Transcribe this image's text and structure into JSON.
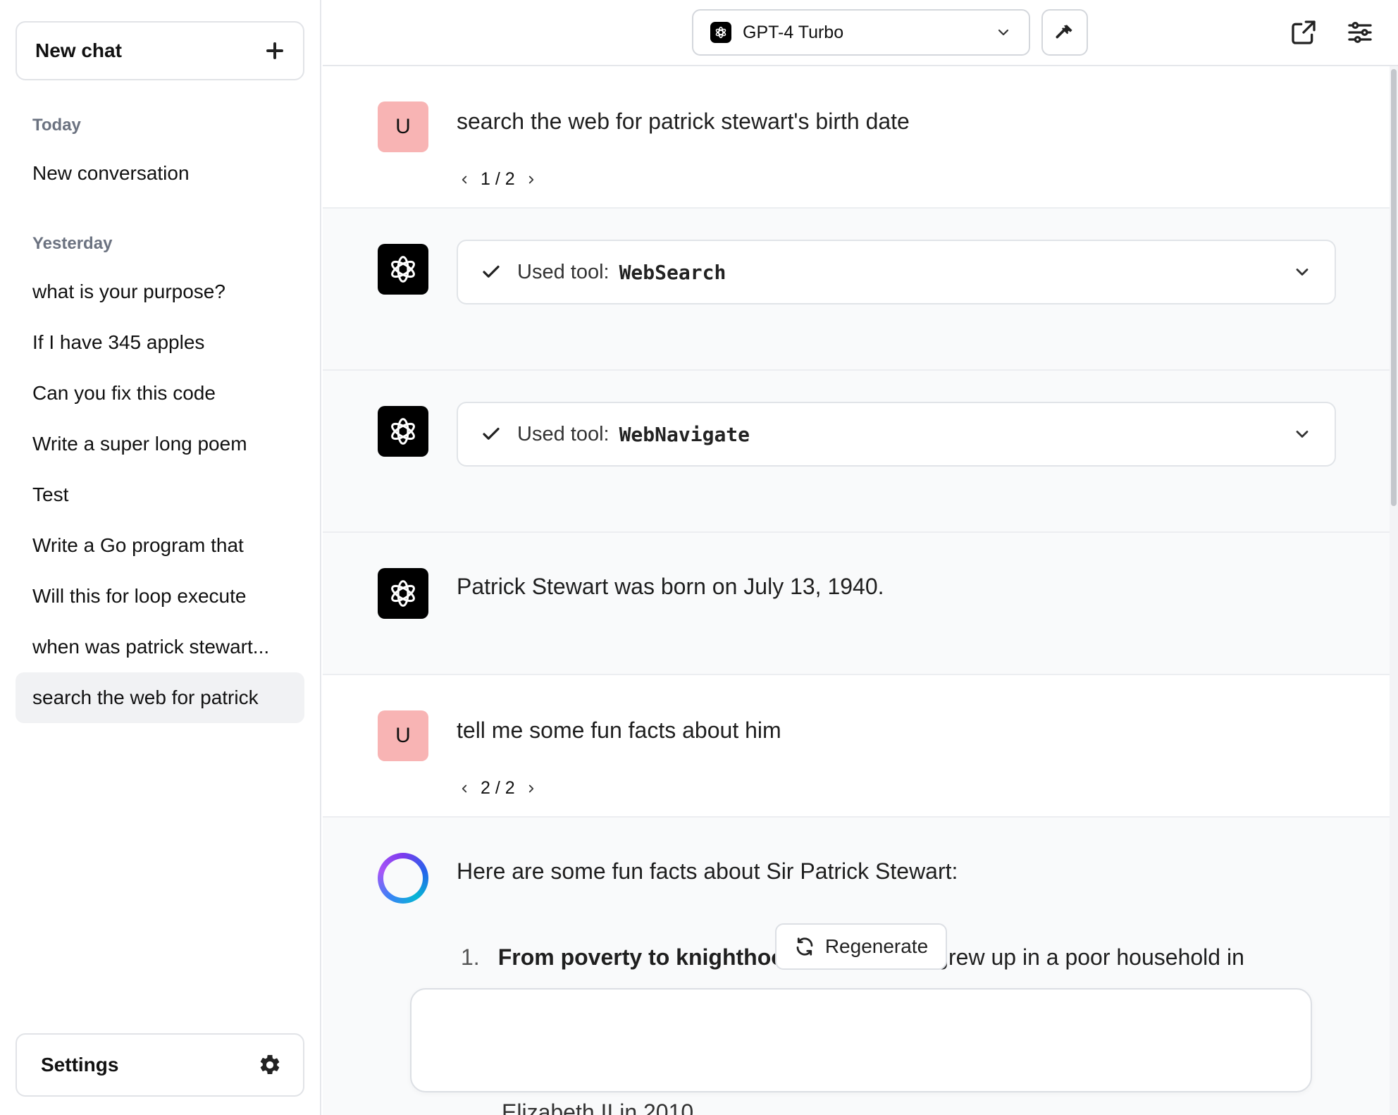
{
  "sidebar": {
    "new_chat_label": "New chat",
    "sections": [
      {
        "label": "Today"
      },
      {
        "label": "Yesterday"
      }
    ],
    "today_items": [
      {
        "label": "New conversation"
      }
    ],
    "yesterday_items": [
      {
        "label": "what is your purpose?"
      },
      {
        "label": "If I have 345 apples"
      },
      {
        "label": "Can you fix this code"
      },
      {
        "label": "Write a super long poem"
      },
      {
        "label": "Test"
      },
      {
        "label": "Write a Go program that"
      },
      {
        "label": "Will this for loop execute"
      },
      {
        "label": "when was patrick stewart..."
      },
      {
        "label": "search the web for patrick",
        "active": true
      }
    ],
    "settings_label": "Settings"
  },
  "header": {
    "model_name": "GPT-4 Turbo",
    "icons": [
      "openai-logo-icon",
      "chevron-down-icon",
      "hammer-icon",
      "share-external-icon",
      "sliders-icon"
    ]
  },
  "messages": [
    {
      "role": "user",
      "avatar_letter": "U",
      "text": "search the web for patrick stewart's birth date",
      "pager": "1 / 2"
    },
    {
      "role": "assistant",
      "tool_prefix": "Used tool:",
      "tool_name": "WebSearch"
    },
    {
      "role": "assistant",
      "tool_prefix": "Used tool:",
      "tool_name": "WebNavigate"
    },
    {
      "role": "assistant",
      "text": "Patrick Stewart was born on July 13, 1940."
    },
    {
      "role": "user",
      "avatar_letter": "U",
      "text": "tell me some fun facts about him",
      "pager": "2 / 2"
    },
    {
      "role": "assistant",
      "streaming": true,
      "intro": "Here are some fun facts about Sir Patrick Stewart:",
      "list": [
        {
          "num": "1.",
          "bold": "From poverty to knighthoo",
          "rest": "rt grew up in a poor household in"
        }
      ],
      "cutoff_text": "Elizabeth II in 2010."
    }
  ],
  "regenerate_label": "Regenerate",
  "input": {
    "placeholder": "",
    "value": ""
  },
  "colors": {
    "user_avatar": "#f8b4b4",
    "bot_avatar": "#000000",
    "active_item_bg": "#f1f2f4",
    "border": "#e1e3e7"
  }
}
